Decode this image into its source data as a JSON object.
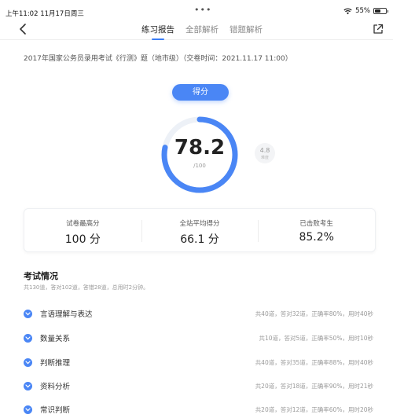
{
  "status_bar": {
    "time_date": "上午11:02   11月17日周三",
    "dots": "•••",
    "battery": "55%",
    "battery_level": 0.55,
    "icons": [
      "wifi-icon",
      "battery-icon"
    ]
  },
  "nav": {
    "tabs": [
      {
        "label": "练习报告",
        "active": true
      },
      {
        "label": "全部解析",
        "active": false
      },
      {
        "label": "错题解析",
        "active": false
      }
    ],
    "icons": [
      "back-chevron-icon",
      "share-icon"
    ]
  },
  "exam": {
    "title": "2017年国家公务员录用考试《行测》题（地市级）（交卷时间：2021.11.17 11:00）"
  },
  "score": {
    "label": "得分",
    "value": "78.2",
    "total": "/100",
    "ring_fraction": 0.782,
    "difficulty_value": "4.8",
    "difficulty_label": "难度"
  },
  "stats": [
    {
      "label": "试卷最高分",
      "value": "100 分"
    },
    {
      "label": "全站平均得分",
      "value": "66.1 分"
    },
    {
      "label": "已击败考生",
      "value": "85.2%"
    }
  ],
  "section": {
    "title": "考试情况",
    "summary": "共130道，答对102道，答错28道，总用时2分钟。"
  },
  "categories": [
    {
      "name": "言语理解与表达",
      "stats": "共40道，答对32道，正确率80%，用时40秒"
    },
    {
      "name": "数量关系",
      "stats": "共10道，答对5道，正确率50%，用时10秒"
    },
    {
      "name": "判断推理",
      "stats": "共40道，答对35道，正确率88%，用时40秒"
    },
    {
      "name": "资料分析",
      "stats": "共20道，答对18道，正确率90%，用时21秒"
    },
    {
      "name": "常识判断",
      "stats": "共20道，答对12道，正确率60%，用时20秒"
    }
  ],
  "colors": {
    "accent": "#4a86f5",
    "ring_track": "#edf1f7"
  }
}
